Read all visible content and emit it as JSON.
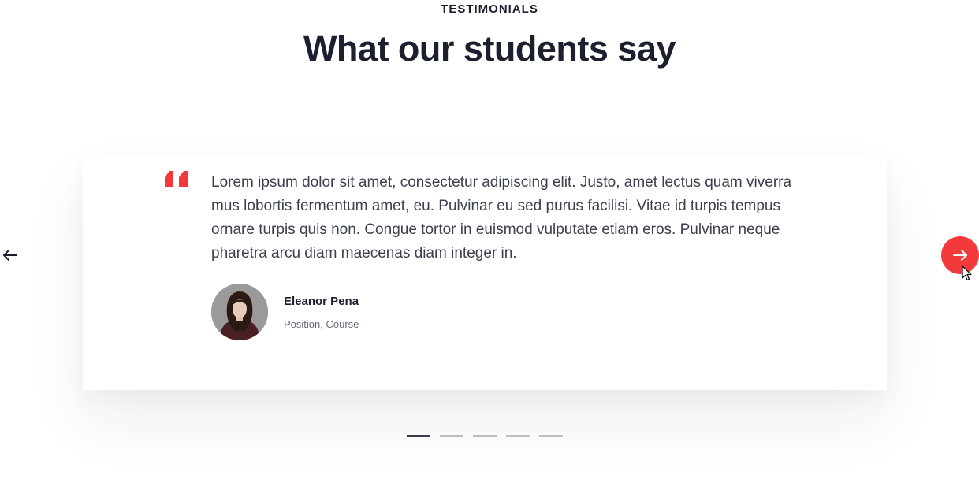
{
  "section": {
    "eyebrow": "TESTIMONIALS",
    "title": "What our students say"
  },
  "testimonial": {
    "quote": "Lorem ipsum dolor sit amet, consectetur adipiscing elit. Justo, amet lectus quam viverra mus lobortis fermentum amet, eu. Pulvinar eu sed purus facilisi. Vitae id turpis tempus ornare turpis quis non. Congue tortor in euismod vulputate etiam eros. Pulvinar neque pharetra arcu diam maecenas diam integer in.",
    "author_name": "Eleanor Pena",
    "author_role": "Position, Course"
  },
  "slider": {
    "slide_count": 5,
    "active_index": 0
  },
  "colors": {
    "accent": "#f23a3a",
    "heading": "#1c1f2e",
    "body_text": "#3d4050",
    "muted_text": "#6b6e7a",
    "dot_inactive": "#bdbec4",
    "dot_active": "#3a3d4c"
  },
  "icons": {
    "quote": "quote-icon",
    "prev": "arrow-left-icon",
    "next": "arrow-right-icon",
    "cursor": "mouse-pointer-icon"
  }
}
